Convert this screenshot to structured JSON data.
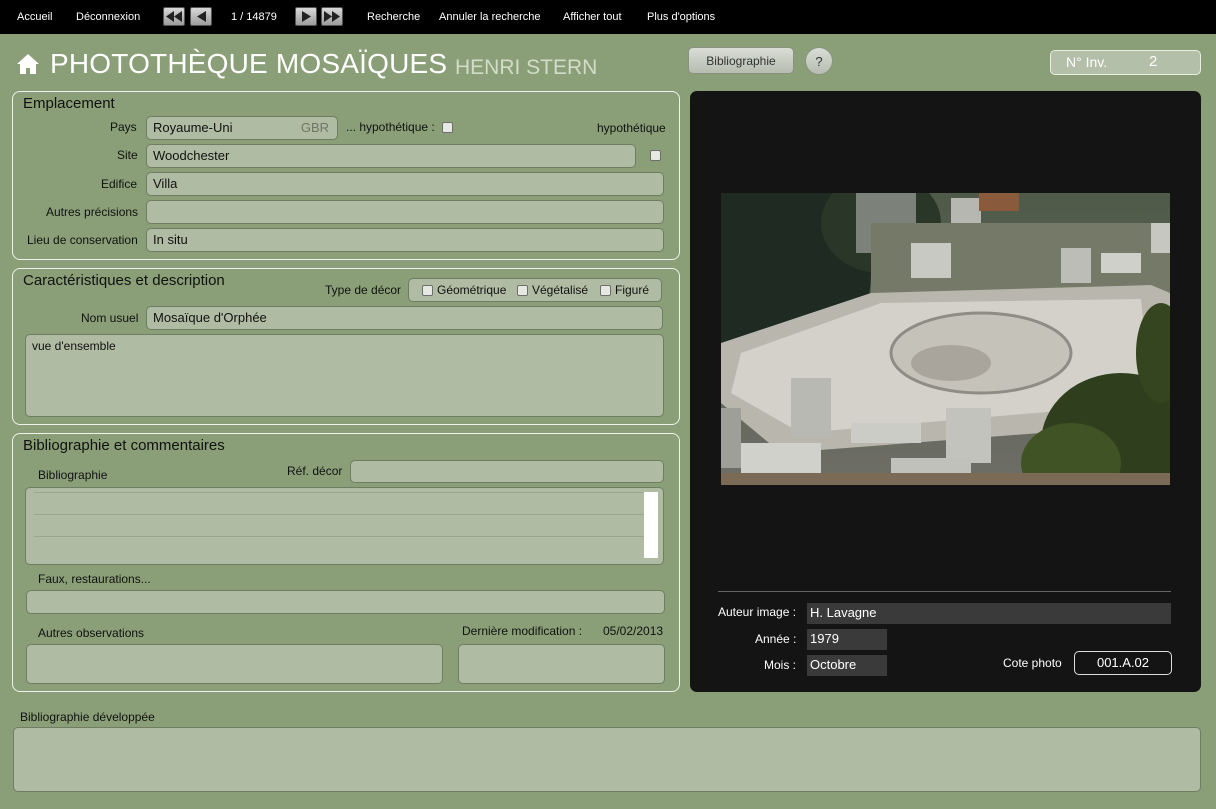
{
  "toolbar": {
    "accueil": "Accueil",
    "deconnexion": "Déconnexion",
    "record_counter": "1 / 14879",
    "recherche": "Recherche",
    "annuler_recherche": "Annuler la recherche",
    "afficher_tout": "Afficher tout",
    "plus_options": "Plus d'options"
  },
  "header": {
    "title": "PHOTOTHÈQUE MOSAÏQUES",
    "subtitle": "HENRI STERN",
    "bibliographie_button": "Bibliographie",
    "help_button": "?",
    "inv_label": "N° Inv.",
    "inv_value": "2"
  },
  "emplacement": {
    "title": "Emplacement",
    "pays_label": "Pays",
    "pays_value": "Royaume-Uni",
    "pays_code": "GBR",
    "hypothetique_label": "... hypothétique :",
    "hypothetique_right": "hypothétique",
    "site_label": "Site",
    "site_value": "Woodchester",
    "edifice_label": "Edifice",
    "edifice_value": "Villa",
    "autres_precisions_label": "Autres précisions",
    "autres_precisions_value": "",
    "lieu_conservation_label": "Lieu de conservation",
    "lieu_conservation_value": "In situ"
  },
  "caracteristiques": {
    "title": "Caractéristiques et description",
    "type_decor_label": "Type de décor",
    "decor_options": [
      "Géométrique",
      "Végétalisé",
      "Figuré"
    ],
    "nom_usuel_label": "Nom usuel",
    "nom_usuel_value": "Mosaïque d'Orphée",
    "description": "vue d'ensemble"
  },
  "bibliographie": {
    "title": "Bibliographie et commentaires",
    "bibliographie_label": "Bibliographie",
    "ref_decor_label": "Réf. décor",
    "ref_decor_value": "",
    "faux_label": "Faux, restaurations...",
    "autres_observations_label": "Autres observations",
    "derniere_modification_label": "Dernière modification :",
    "derniere_modification_value": "05/02/2013"
  },
  "bibliographie_developpee": {
    "label": "Bibliographie développée"
  },
  "image_info": {
    "auteur_label": "Auteur image :",
    "auteur_value": "H. Lavagne",
    "annee_label": "Année :",
    "annee_value": "1979",
    "mois_label": "Mois :",
    "mois_value": "Octobre",
    "cote_label": "Cote photo",
    "cote_value": "001.A.02"
  },
  "colors": {
    "background": "#8a9f77",
    "field": "#b0bba3",
    "toolbar": "#000000",
    "image_panel": "#141414"
  }
}
